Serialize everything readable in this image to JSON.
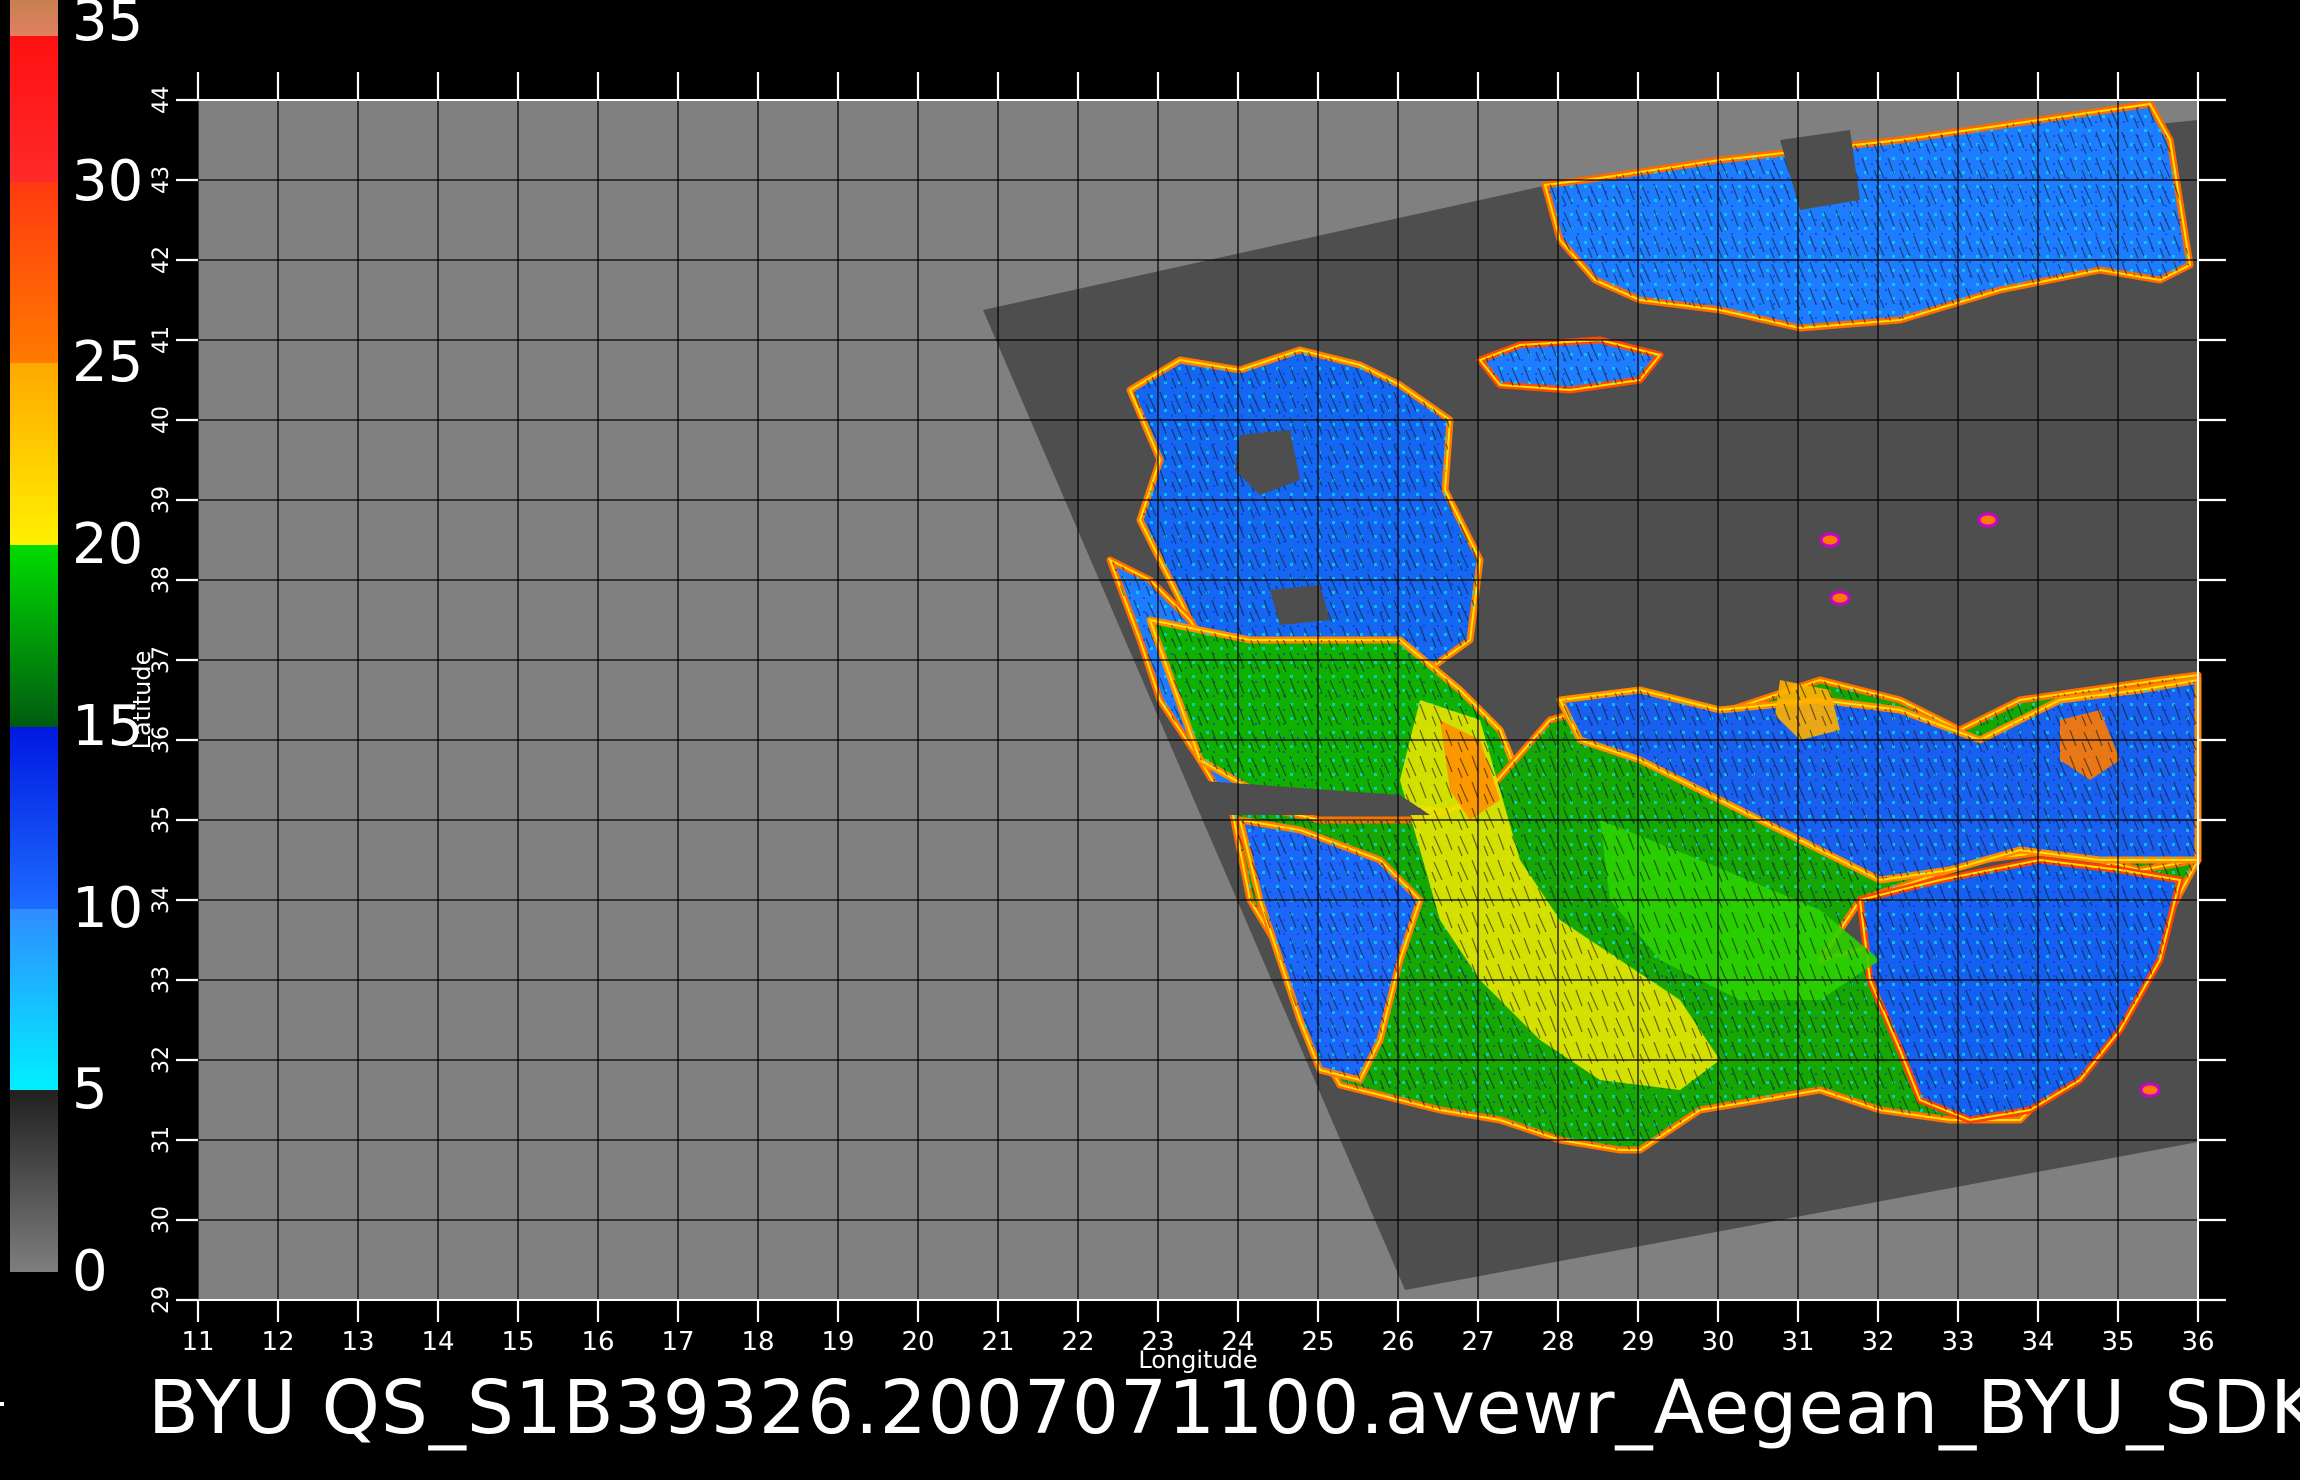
{
  "map": {
    "lon_ticks": [
      "11",
      "12",
      "13",
      "14",
      "15",
      "16",
      "17",
      "18",
      "19",
      "20",
      "21",
      "22",
      "23",
      "24",
      "25",
      "26",
      "27",
      "28",
      "29",
      "30",
      "31",
      "32",
      "33",
      "34",
      "35",
      "36"
    ],
    "lat_ticks": [
      "29",
      "30",
      "31",
      "32",
      "33",
      "34",
      "35",
      "36",
      "37",
      "38",
      "39",
      "40",
      "41",
      "42",
      "43",
      "44"
    ],
    "lon_range": [
      11,
      36
    ],
    "lat_range": [
      29,
      44
    ],
    "xlabel": "Longitude",
    "ylabel": "Latitude",
    "background_color": "#808080",
    "swath_color": "#4e4e4e",
    "grid_color": "#000000"
  },
  "colorbar": {
    "labels": [
      "35",
      "30",
      "25",
      "20",
      "15",
      "10",
      "5",
      "0"
    ],
    "range": [
      0,
      35
    ],
    "segments": [
      {
        "from": 0,
        "to": 5,
        "colors": [
          "#7e7e7e",
          "#202020"
        ]
      },
      {
        "from": 5,
        "to": 10,
        "colors": [
          "#00f0ff",
          "#2f8cff"
        ]
      },
      {
        "from": 10,
        "to": 15,
        "colors": [
          "#1d6cff",
          "#0018e0"
        ]
      },
      {
        "from": 15,
        "to": 20,
        "colors": [
          "#005a10",
          "#00dc00"
        ]
      },
      {
        "from": 20,
        "to": 25,
        "colors": [
          "#fff000",
          "#ffa800"
        ]
      },
      {
        "from": 25,
        "to": 30,
        "colors": [
          "#ff7a00",
          "#ff3a10"
        ]
      },
      {
        "from": 30,
        "to": 34,
        "colors": [
          "#ff2a2a",
          "#ff1010"
        ]
      },
      {
        "from": 34,
        "to": 35,
        "colors": [
          "#e08060",
          "#c88050"
        ]
      }
    ]
  },
  "footer": {
    "text": "BYU  QS_S1B39326.2007071100.avewr_Aegean_BYU_SDK"
  }
}
